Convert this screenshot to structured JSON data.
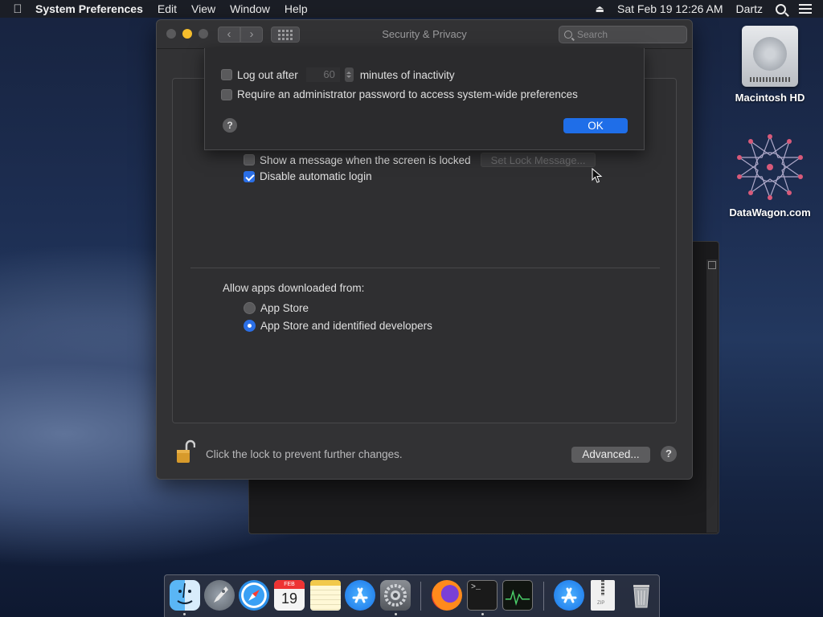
{
  "menubar": {
    "app_name": "System Preferences",
    "menus": [
      "Edit",
      "View",
      "Window",
      "Help"
    ],
    "datetime": "Sat Feb 19  12:26 AM",
    "user": "Dartz"
  },
  "desktop": {
    "icons": [
      {
        "label": "Macintosh HD",
        "icon": "hard-drive-icon"
      },
      {
        "label": "DataWagon.com",
        "icon": "datawagon-logo-icon"
      }
    ]
  },
  "window": {
    "title": "Security & Privacy",
    "search_placeholder": "Search",
    "nav": {
      "back": "‹",
      "forward": "›"
    }
  },
  "sheet": {
    "logout_label": "Log out after",
    "logout_minutes": "60",
    "logout_suffix": "minutes of inactivity",
    "logout_checked": false,
    "admin_label": "Require an administrator password to access system-wide preferences",
    "admin_checked": false,
    "help": "?",
    "ok": "OK"
  },
  "general": {
    "show_message_label": "Show a message when the screen is locked",
    "show_message_checked": false,
    "set_lock_message_button": "Set Lock Message...",
    "disable_autologin_label": "Disable automatic login",
    "disable_autologin_checked": true
  },
  "allow_apps": {
    "heading": "Allow apps downloaded from:",
    "options": [
      {
        "label": "App Store",
        "selected": false
      },
      {
        "label": "App Store and identified developers",
        "selected": true
      }
    ]
  },
  "footer": {
    "lock_text": "Click the lock to prevent further changes.",
    "advanced_button": "Advanced...",
    "help": "?"
  },
  "dock": {
    "items": [
      "finder-icon",
      "launchpad-icon",
      "safari-icon",
      "calendar-icon",
      "notes-icon",
      "app-store-icon",
      "system-preferences-icon",
      "firefox-icon",
      "terminal-icon",
      "activity-monitor-icon",
      "app-store-download-icon",
      "archive-icon",
      "trash-icon"
    ],
    "calendar_month": "FEB",
    "calendar_day": "19",
    "terminal_prompt": ">_",
    "archive_label": "ZIP"
  },
  "colors": {
    "accent": "#2b6fe6",
    "minimize": "#f5bd2c",
    "window_bg": "#323234"
  }
}
